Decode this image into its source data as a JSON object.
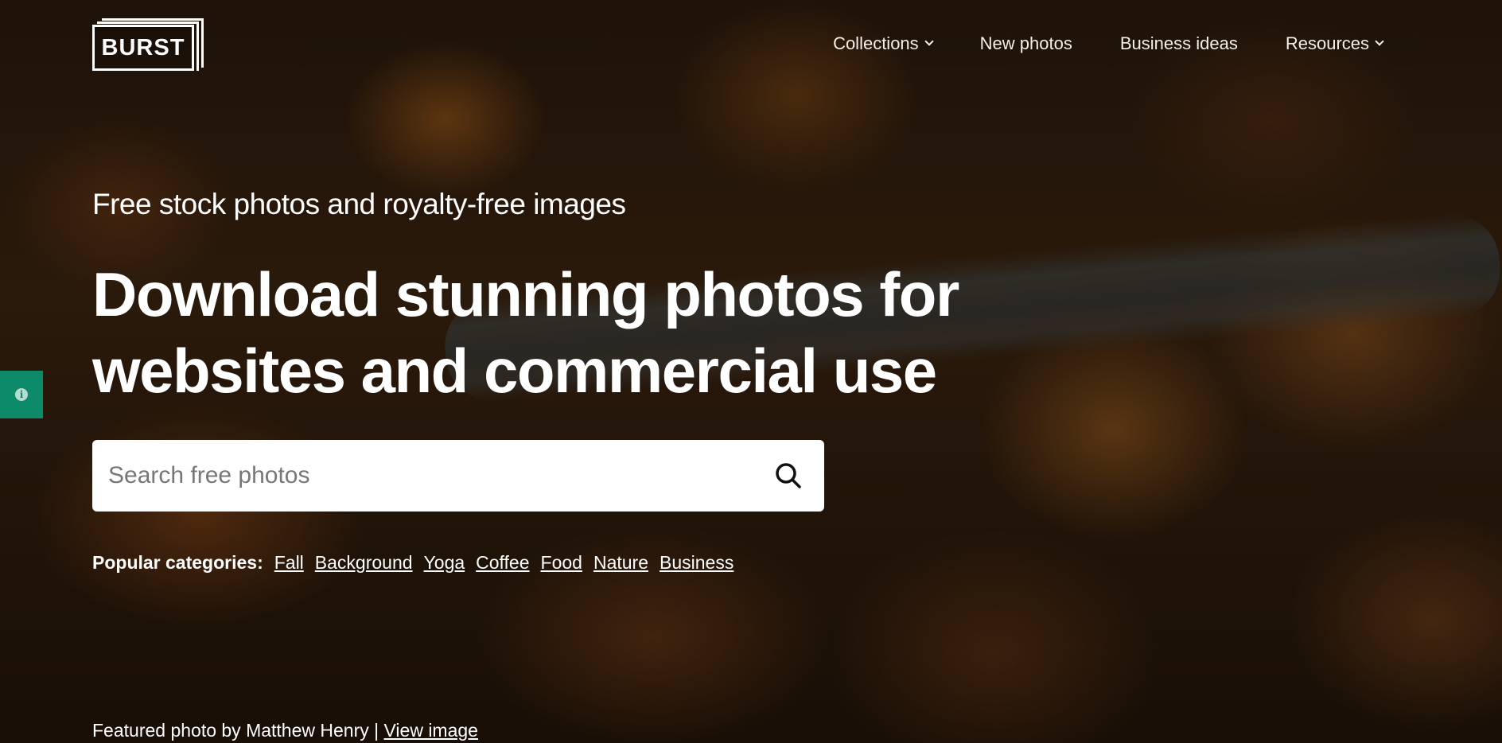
{
  "logo": {
    "text": "BURST"
  },
  "nav": {
    "items": [
      {
        "label": "Collections",
        "dropdown": true
      },
      {
        "label": "New photos",
        "dropdown": false
      },
      {
        "label": "Business ideas",
        "dropdown": false
      },
      {
        "label": "Resources",
        "dropdown": true
      }
    ]
  },
  "hero": {
    "tagline": "Free stock photos and royalty-free images",
    "headline_line1": "Download stunning photos for",
    "headline_line2": "websites and commercial use"
  },
  "search": {
    "placeholder": "Search free photos",
    "value": ""
  },
  "categories": {
    "label": "Popular categories:",
    "items": [
      "Fall",
      "Background",
      "Yoga",
      "Coffee",
      "Food",
      "Nature",
      "Business"
    ]
  },
  "credit": {
    "text": "Featured photo by Matthew Henry |",
    "link": "View image"
  },
  "colors": {
    "side_tab": "#0d8a68",
    "text": "#ffffff"
  },
  "icons": {
    "search": "search-icon",
    "side_tab": "info-icon",
    "dropdown": "chevron-down-icon"
  }
}
